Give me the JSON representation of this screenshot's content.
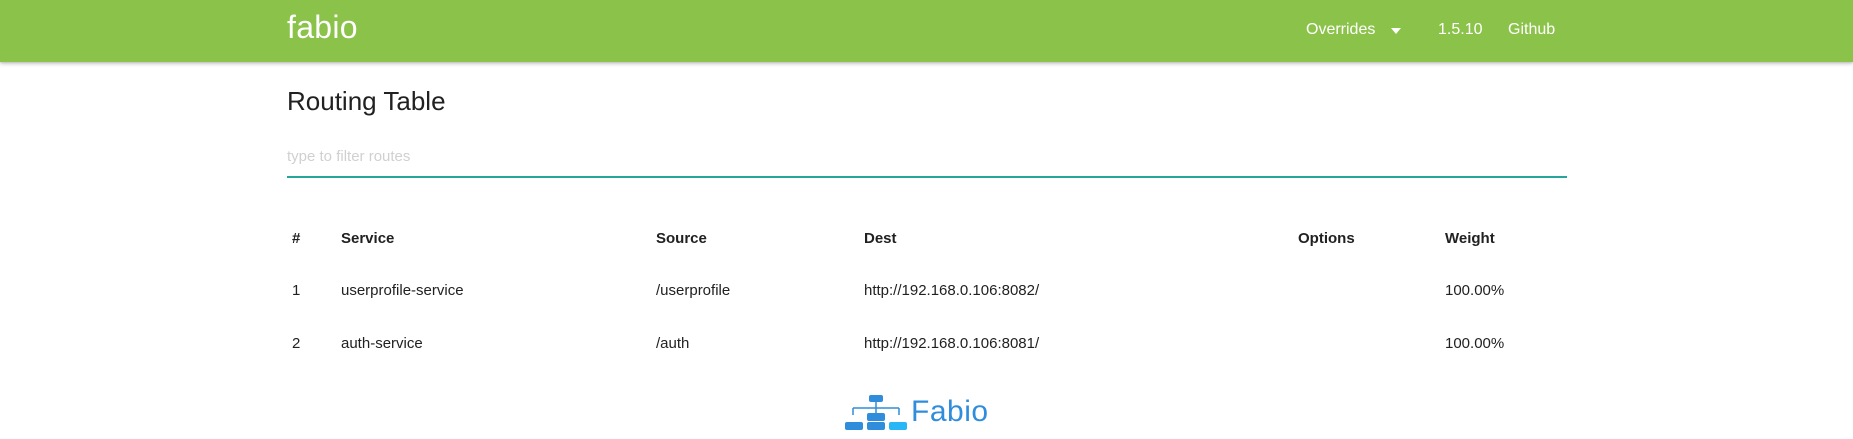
{
  "navbar": {
    "brand": "fabio",
    "overrides_label": "Overrides",
    "version_label": "1.5.10",
    "github_label": "Github"
  },
  "page": {
    "title": "Routing Table"
  },
  "filter": {
    "placeholder": "type to filter routes",
    "value": ""
  },
  "table": {
    "headers": [
      "#",
      "Service",
      "Source",
      "Dest",
      "Options",
      "Weight"
    ],
    "rows": [
      [
        "1",
        "userprofile-service",
        "/userprofile",
        "http://192.168.0.106:8082/",
        "",
        "100.00%"
      ],
      [
        "2",
        "auth-service",
        "/auth",
        "http://192.168.0.106:8081/",
        "",
        "100.00%"
      ]
    ]
  },
  "footer": {
    "logo_text": "Fabio",
    "logo_icon": "network-tree-icon"
  },
  "colors": {
    "navbar": "#8bc34a",
    "input_underline": "#26a69a",
    "logo_blue": "#2f8ddc",
    "logo_light_blue": "#29b6f6"
  }
}
